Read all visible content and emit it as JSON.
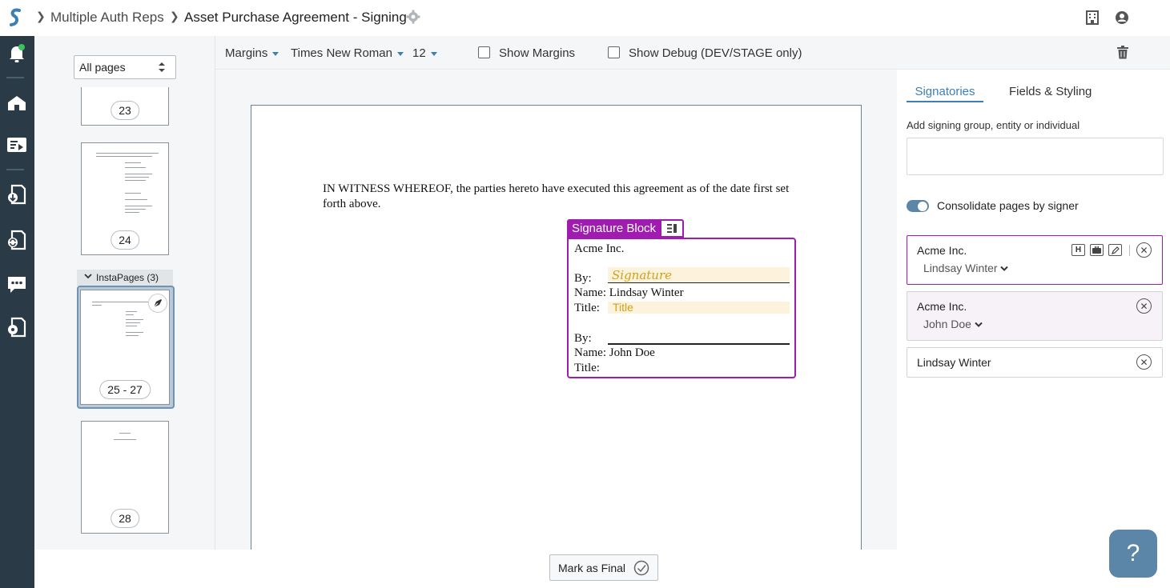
{
  "breadcrumb": {
    "parent": "Multiple Auth Reps",
    "current": "Asset Purchase Agreement - Signing"
  },
  "icons": {
    "logo": "signing-logo-icon",
    "settings": "gear-icon",
    "building": "building-icon",
    "user": "user-icon"
  },
  "colors": {
    "rail": "#2a3b47",
    "accent": "#3d7fb5",
    "signature_block": "#a01bb0",
    "field_fill": "#fdf3dd",
    "field_text": "#d4a017"
  },
  "thumbnails": {
    "filter": "All pages",
    "pages": [
      "23",
      "24",
      "25 - 27",
      "28"
    ],
    "group_label": "InstaPages (3)"
  },
  "toolbar": {
    "margins": "Margins",
    "font": "Times New Roman",
    "size": "12",
    "show_margins": "Show Margins",
    "show_debug": "Show Debug (DEV/STAGE only)"
  },
  "document": {
    "witness_line1": "IN WITNESS WHEREOF, the parties hereto have executed this agreement as of the date first set",
    "witness_line2": "forth above.",
    "block_label": "Signature Block",
    "entity": "Acme Inc.",
    "by_label": "By:",
    "name_label": "Name:",
    "title_label": "Title:",
    "signature_placeholder": "Signature",
    "title_placeholder": "Title",
    "signer1": "Lindsay Winter",
    "signer2": "John Doe"
  },
  "right_panel": {
    "tabs": [
      "Signatories",
      "Fields & Styling"
    ],
    "add_label": "Add signing group, entity or individual",
    "add_value": "",
    "consolidate_label": "Consolidate pages by signer",
    "consolidate_on": true,
    "signers": [
      {
        "entity": "Acme Inc.",
        "person": "Lindsay Winter"
      },
      {
        "entity": "Acme Inc.",
        "person": "John Doe"
      },
      {
        "entity": "",
        "person": "Lindsay Winter"
      }
    ],
    "header_badge": "H"
  },
  "footer": {
    "mark_final": "Mark as Final",
    "help": "?"
  }
}
